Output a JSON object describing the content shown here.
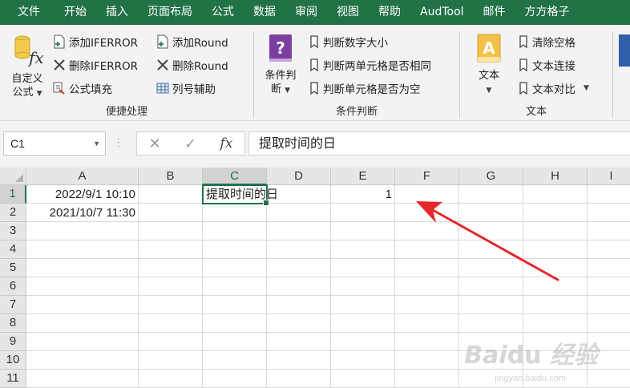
{
  "tabs": [
    "文件",
    "开始",
    "插入",
    "页面布局",
    "公式",
    "数据",
    "审阅",
    "视图",
    "帮助",
    "AudTool",
    "邮件",
    "方方格子"
  ],
  "ribbon": {
    "group1": {
      "label": "便捷处理",
      "big": {
        "line1": "自定义",
        "line2": "公式"
      },
      "items": [
        "添加IFERROR",
        "删除IFERROR",
        "公式填充",
        "添加Round",
        "删除Round",
        "列号辅助"
      ]
    },
    "group2": {
      "label": "条件判断",
      "big": {
        "line1": "条件判",
        "line2": "断"
      },
      "items": [
        "判断数字大小",
        "判断两单元格是否相同",
        "判断单元格是否为空"
      ]
    },
    "group3": {
      "label": "文本",
      "big": {
        "line1": "文本"
      },
      "items": [
        "清除空格",
        "文本连接",
        "文本对比"
      ]
    }
  },
  "formula_bar": {
    "name_box": "C1",
    "formula": "提取时间的日"
  },
  "grid": {
    "columns": [
      "A",
      "B",
      "C",
      "D",
      "E",
      "F",
      "G",
      "H",
      "I"
    ],
    "rows": [
      "1",
      "2",
      "3",
      "4",
      "5",
      "6",
      "7",
      "8",
      "9",
      "10",
      "11"
    ],
    "cells": {
      "A1": "2022/9/1 10:10",
      "A2": "2021/10/7 11:30",
      "C1": "提取时间的日",
      "E1": "1"
    }
  },
  "colors": {
    "accent": "#217346",
    "annotation_arrow": "#e8262b"
  }
}
